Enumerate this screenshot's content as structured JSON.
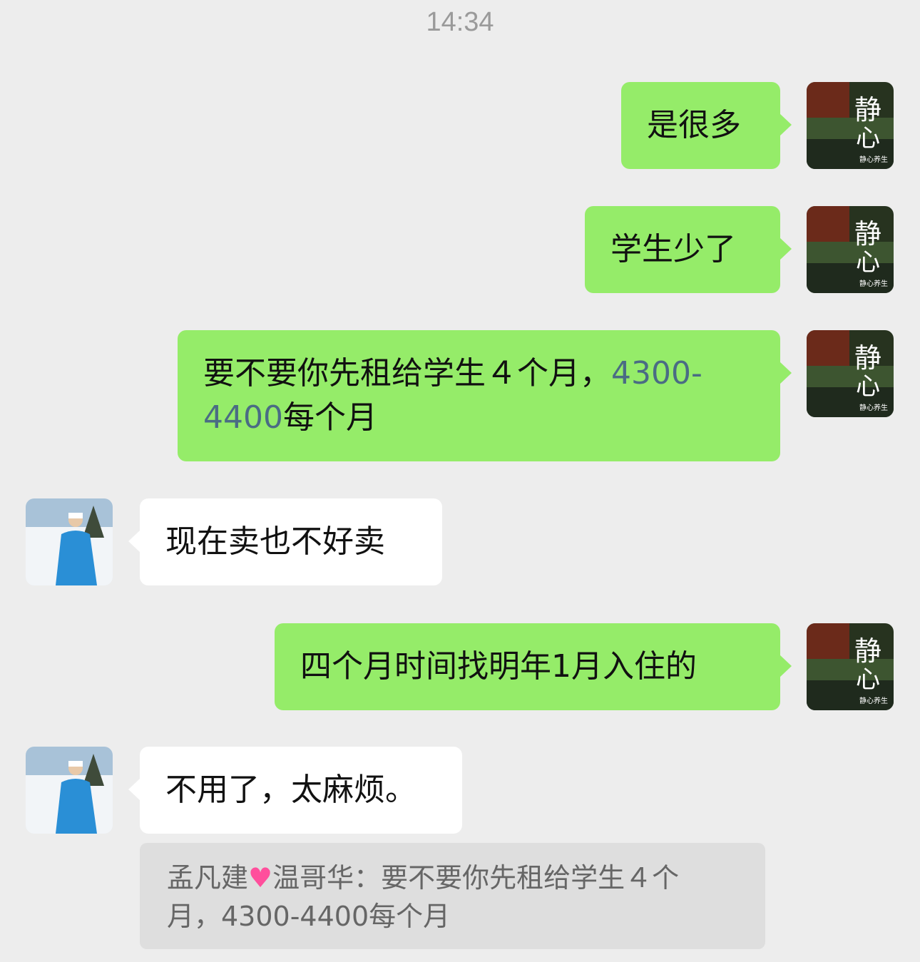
{
  "timestamp": "14:34",
  "messages": [
    {
      "id": "m1",
      "side": "me",
      "text": "是很多"
    },
    {
      "id": "m2",
      "side": "me",
      "text": "学生少了"
    },
    {
      "id": "m3",
      "side": "me",
      "text_a": "要不要你先租给学生４个月，",
      "num_a": "4300-",
      "num_b": "4400",
      "text_b": "每个月"
    },
    {
      "id": "m4",
      "side": "other",
      "text": "现在卖也不好卖"
    },
    {
      "id": "m5",
      "side": "me",
      "text": "四个月时间找明年1月入住的"
    },
    {
      "id": "m6",
      "side": "other",
      "text": "不用了，太麻烦。"
    }
  ],
  "quote": {
    "name_a": "孟凡建",
    "name_b": "温哥华",
    "heart_icon": "sparkling-heart",
    "line1_text": "：要不要你先租给学生４个",
    "line2_text": "月，4300-4400每个月"
  },
  "avatars": {
    "me_text_big_1": "静",
    "me_text_big_2": "心",
    "me_text_small": "静心养生"
  },
  "colors": {
    "background": "#ededed",
    "my_bubble": "#95ec69",
    "other_bubble": "#ffffff",
    "quote_bg": "#dedede",
    "number_link": "#4a6c84"
  }
}
